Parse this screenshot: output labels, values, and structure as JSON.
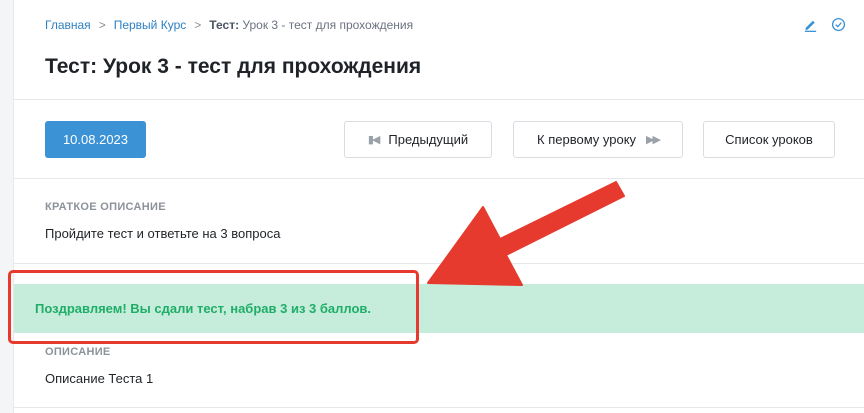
{
  "breadcrumb": {
    "home": "Главная",
    "separator": ">",
    "course": "Первый Курс",
    "current_label": "Тест:",
    "current": "Урок 3 - тест для прохождения"
  },
  "title": {
    "prefix": "Тест:",
    "text": "Урок 3 - тест для прохождения"
  },
  "icons": {
    "edit": "pencil-icon",
    "complete": "check-circle-icon"
  },
  "toolbar": {
    "date": "10.08.2023",
    "prev_label": "Предыдущий",
    "first_label": "К первому уроку",
    "list_label": "Список уроков"
  },
  "short_description": {
    "label": "КРАТКОЕ ОПИСАНИЕ",
    "text": "Пройдите тест и ответьте на 3 вопроса"
  },
  "alert": {
    "text": "Поздравляем! Вы сдали тест, набрав 3 из 3 баллов."
  },
  "description": {
    "label": "ОПИСАНИЕ",
    "text": "Описание Теста 1"
  },
  "colors": {
    "accent": "#3b93d6",
    "success_bg": "#c6ecdb",
    "success_text": "#1fae68",
    "annotation": "#e63a2e"
  }
}
